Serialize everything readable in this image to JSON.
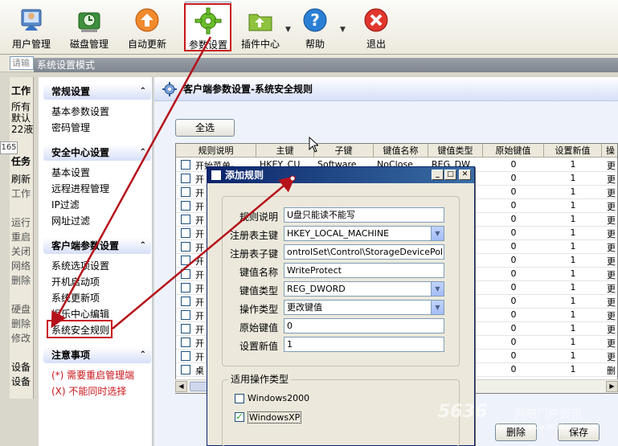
{
  "toolbar": {
    "buttons": [
      {
        "label": "用户管理",
        "icon": "users-icon"
      },
      {
        "label": "磁盘管理",
        "icon": "disk-icon"
      },
      {
        "label": "自动更新",
        "icon": "update-icon"
      },
      {
        "label": "参数设置",
        "icon": "gear-icon"
      },
      {
        "label": "插件中心",
        "icon": "plugin-icon"
      },
      {
        "label": "帮助",
        "icon": "help-icon"
      },
      {
        "label": "退出",
        "icon": "exit-icon"
      }
    ]
  },
  "search": {
    "value": "请输"
  },
  "mode_bar": {
    "title": "系统设置模式"
  },
  "left_strip": {
    "lines": [
      "工作",
      "所有",
      "默认",
      "22液",
      "165",
      "任务",
      "刷新",
      "工作",
      "运行",
      "重启",
      "关闭",
      "网络",
      "删除",
      "硬盘",
      "删除",
      "修改",
      "设备",
      "设备"
    ]
  },
  "nav": {
    "sections": [
      {
        "title": "常规设置",
        "items": [
          "基本参数设置",
          "密码管理"
        ]
      },
      {
        "title": "安全中心设置",
        "items": [
          "基本设置",
          "远程进程管理",
          "IP过滤",
          "网址过滤"
        ]
      },
      {
        "title": "客户端参数设置",
        "items": [
          "系统选项设置",
          "开机启动项",
          "系统更新项",
          "娱乐中心编辑",
          "系统安全规则"
        ]
      },
      {
        "title": "注意事项",
        "items": [
          "(*) 需要重启管理端",
          "(X) 不能同时选择"
        ]
      }
    ]
  },
  "main": {
    "title": "客户端参数设置-系统安全规则",
    "select_all": "全选",
    "delete": "删除",
    "save": "保存"
  },
  "grid": {
    "columns": [
      "规则说明",
      "主键",
      "子键",
      "键值名称",
      "键值类型",
      "原始键值",
      "设置新值",
      "操"
    ],
    "first_row": {
      "desc": "开始菜单-",
      "key": "HKEY_CU",
      "subkey": "Software",
      "name": "NoClose",
      "type": "REG_DW"
    },
    "rows": [
      {
        "desc": "开始菜单-",
        "orig": "0",
        "new": "1",
        "op": "更"
      },
      {
        "desc": "开",
        "orig": "0",
        "new": "1",
        "op": "更"
      },
      {
        "desc": "开",
        "orig": "0",
        "new": "1",
        "op": "更"
      },
      {
        "desc": "开",
        "orig": "0",
        "new": "1",
        "op": "更"
      },
      {
        "desc": "开",
        "orig": "0",
        "new": "1",
        "op": "更"
      },
      {
        "desc": "开",
        "orig": "0",
        "new": "1",
        "op": "更"
      },
      {
        "desc": "开",
        "orig": "0",
        "new": "1",
        "op": "更"
      },
      {
        "desc": "开",
        "orig": "0",
        "new": "1",
        "op": "更"
      },
      {
        "desc": "开",
        "orig": "0",
        "new": "1",
        "op": "更"
      },
      {
        "desc": "开",
        "orig": "0",
        "new": "1",
        "op": "更"
      },
      {
        "desc": "开",
        "orig": "0",
        "new": "1",
        "op": "更"
      },
      {
        "desc": "开",
        "orig": "0",
        "new": "1",
        "op": "更"
      },
      {
        "desc": "开",
        "orig": "0",
        "new": "1",
        "op": "更"
      },
      {
        "desc": "开",
        "orig": "0",
        "new": "1",
        "op": "更"
      },
      {
        "desc": "开",
        "orig": "0",
        "new": "1",
        "op": "更"
      },
      {
        "desc": "桌",
        "orig": "0",
        "new": "1",
        "op": "删"
      }
    ]
  },
  "dialog": {
    "title": "添加规则",
    "fields": [
      {
        "label": "规则说明",
        "value": "U盘只能读不能写",
        "type": "text"
      },
      {
        "label": "注册表主键",
        "value": "HKEY_LOCAL_MACHINE",
        "type": "select"
      },
      {
        "label": "注册表子键",
        "value": "ontrolSet\\Control\\StorageDevicePolicies",
        "type": "text"
      },
      {
        "label": "键值名称",
        "value": "WriteProtect",
        "type": "text"
      },
      {
        "label": "键值类型",
        "value": "REG_DWORD",
        "type": "select"
      },
      {
        "label": "操作类型",
        "value": "更改键值",
        "type": "select"
      },
      {
        "label": "原始键值",
        "value": "0",
        "type": "text"
      },
      {
        "label": "设置新值",
        "value": "1",
        "type": "text"
      }
    ],
    "group_title": "适用操作类型",
    "os_options": [
      {
        "label": "Windows2000",
        "checked": false
      },
      {
        "label": "WindowsXP",
        "checked": true
      }
    ]
  },
  "watermark": {
    "big": "5636",
    "text": "网吧门户资讯",
    "url": "www.5636.com"
  },
  "colors": {
    "highlight_border": "#c8161c",
    "arrow": "#b5121b",
    "nav_header": "#d6dff7",
    "title_bar": "#0a246a"
  }
}
